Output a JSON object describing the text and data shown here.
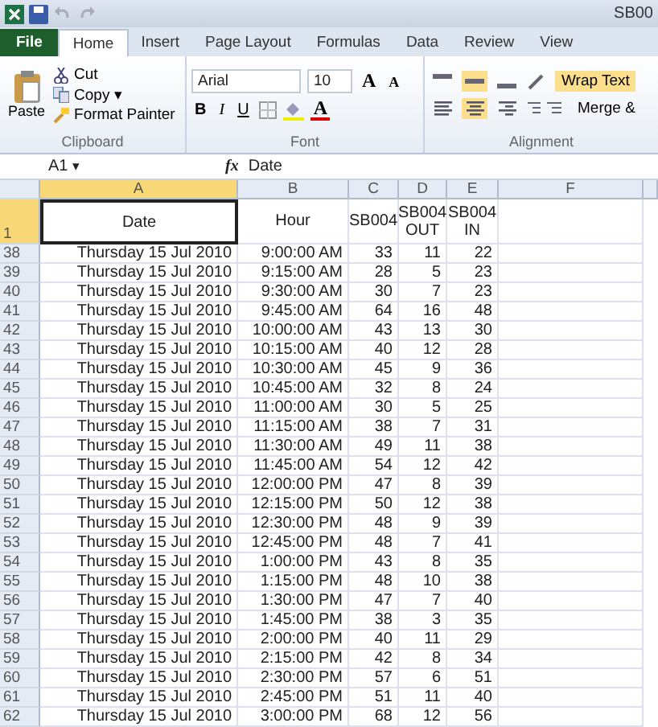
{
  "window": {
    "title": "SB00"
  },
  "tabs": [
    {
      "label": "File",
      "kind": "file",
      "selected": false
    },
    {
      "label": "Home",
      "kind": "tab",
      "selected": true
    },
    {
      "label": "Insert",
      "kind": "tab",
      "selected": false
    },
    {
      "label": "Page Layout",
      "kind": "tab",
      "selected": false
    },
    {
      "label": "Formulas",
      "kind": "tab",
      "selected": false
    },
    {
      "label": "Data",
      "kind": "tab",
      "selected": false
    },
    {
      "label": "Review",
      "kind": "tab",
      "selected": false
    },
    {
      "label": "View",
      "kind": "tab",
      "selected": false
    }
  ],
  "clipboard": {
    "label": "Clipboard",
    "paste": "Paste",
    "cut": "Cut",
    "copy": "Copy",
    "copy_caret": "▾",
    "format_painter": "Format Painter"
  },
  "font": {
    "label": "Font",
    "name": "Arial",
    "size": "10",
    "grow": "A",
    "shrink": "A",
    "bold": "B",
    "italic": "I",
    "underline": "U",
    "color_letter": "A"
  },
  "alignment": {
    "label": "Alignment",
    "wrap_text": "Wrap Text",
    "merge": "Merge &",
    "vertical": [
      {
        "kind": "top",
        "selected": false
      },
      {
        "kind": "middle",
        "selected": true
      },
      {
        "kind": "bottom",
        "selected": false
      }
    ],
    "horizontal": [
      {
        "kind": "left",
        "selected": false
      },
      {
        "kind": "center",
        "selected": true
      },
      {
        "kind": "right",
        "selected": false
      }
    ]
  },
  "formula_bar": {
    "name_box": "A1",
    "name_box_caret": "▾",
    "fx": "fx",
    "value": "Date"
  },
  "columns": [
    {
      "label": "A",
      "selected": true
    },
    {
      "label": "B",
      "selected": false
    },
    {
      "label": "C",
      "selected": false
    },
    {
      "label": "D",
      "selected": false
    },
    {
      "label": "E",
      "selected": false
    },
    {
      "label": "F",
      "selected": false
    }
  ],
  "header_row": {
    "row": "1",
    "selected": true,
    "cells": [
      "Date",
      "Hour",
      "SB004",
      "SB004 OUT",
      "SB004 IN"
    ]
  },
  "rows": [
    {
      "row": "38",
      "cells": [
        "Thursday 15 Jul 2010",
        "9:00:00 AM",
        "33",
        "11",
        "22"
      ]
    },
    {
      "row": "39",
      "cells": [
        "Thursday 15 Jul 2010",
        "9:15:00 AM",
        "28",
        "5",
        "23"
      ]
    },
    {
      "row": "40",
      "cells": [
        "Thursday 15 Jul 2010",
        "9:30:00 AM",
        "30",
        "7",
        "23"
      ]
    },
    {
      "row": "41",
      "cells": [
        "Thursday 15 Jul 2010",
        "9:45:00 AM",
        "64",
        "16",
        "48"
      ]
    },
    {
      "row": "42",
      "cells": [
        "Thursday 15 Jul 2010",
        "10:00:00 AM",
        "43",
        "13",
        "30"
      ]
    },
    {
      "row": "43",
      "cells": [
        "Thursday 15 Jul 2010",
        "10:15:00 AM",
        "40",
        "12",
        "28"
      ]
    },
    {
      "row": "44",
      "cells": [
        "Thursday 15 Jul 2010",
        "10:30:00 AM",
        "45",
        "9",
        "36"
      ]
    },
    {
      "row": "45",
      "cells": [
        "Thursday 15 Jul 2010",
        "10:45:00 AM",
        "32",
        "8",
        "24"
      ]
    },
    {
      "row": "46",
      "cells": [
        "Thursday 15 Jul 2010",
        "11:00:00 AM",
        "30",
        "5",
        "25"
      ]
    },
    {
      "row": "47",
      "cells": [
        "Thursday 15 Jul 2010",
        "11:15:00 AM",
        "38",
        "7",
        "31"
      ]
    },
    {
      "row": "48",
      "cells": [
        "Thursday 15 Jul 2010",
        "11:30:00 AM",
        "49",
        "11",
        "38"
      ]
    },
    {
      "row": "49",
      "cells": [
        "Thursday 15 Jul 2010",
        "11:45:00 AM",
        "54",
        "12",
        "42"
      ]
    },
    {
      "row": "50",
      "cells": [
        "Thursday 15 Jul 2010",
        "12:00:00 PM",
        "47",
        "8",
        "39"
      ]
    },
    {
      "row": "51",
      "cells": [
        "Thursday 15 Jul 2010",
        "12:15:00 PM",
        "50",
        "12",
        "38"
      ]
    },
    {
      "row": "52",
      "cells": [
        "Thursday 15 Jul 2010",
        "12:30:00 PM",
        "48",
        "9",
        "39"
      ]
    },
    {
      "row": "53",
      "cells": [
        "Thursday 15 Jul 2010",
        "12:45:00 PM",
        "48",
        "7",
        "41"
      ]
    },
    {
      "row": "54",
      "cells": [
        "Thursday 15 Jul 2010",
        "1:00:00 PM",
        "43",
        "8",
        "35"
      ]
    },
    {
      "row": "55",
      "cells": [
        "Thursday 15 Jul 2010",
        "1:15:00 PM",
        "48",
        "10",
        "38"
      ]
    },
    {
      "row": "56",
      "cells": [
        "Thursday 15 Jul 2010",
        "1:30:00 PM",
        "47",
        "7",
        "40"
      ]
    },
    {
      "row": "57",
      "cells": [
        "Thursday 15 Jul 2010",
        "1:45:00 PM",
        "38",
        "3",
        "35"
      ]
    },
    {
      "row": "58",
      "cells": [
        "Thursday 15 Jul 2010",
        "2:00:00 PM",
        "40",
        "11",
        "29"
      ]
    },
    {
      "row": "59",
      "cells": [
        "Thursday 15 Jul 2010",
        "2:15:00 PM",
        "42",
        "8",
        "34"
      ]
    },
    {
      "row": "60",
      "cells": [
        "Thursday 15 Jul 2010",
        "2:30:00 PM",
        "57",
        "6",
        "51"
      ]
    },
    {
      "row": "61",
      "cells": [
        "Thursday 15 Jul 2010",
        "2:45:00 PM",
        "51",
        "11",
        "40"
      ]
    },
    {
      "row": "62",
      "cells": [
        "Thursday 15 Jul 2010",
        "3:00:00 PM",
        "68",
        "12",
        "56"
      ]
    }
  ]
}
